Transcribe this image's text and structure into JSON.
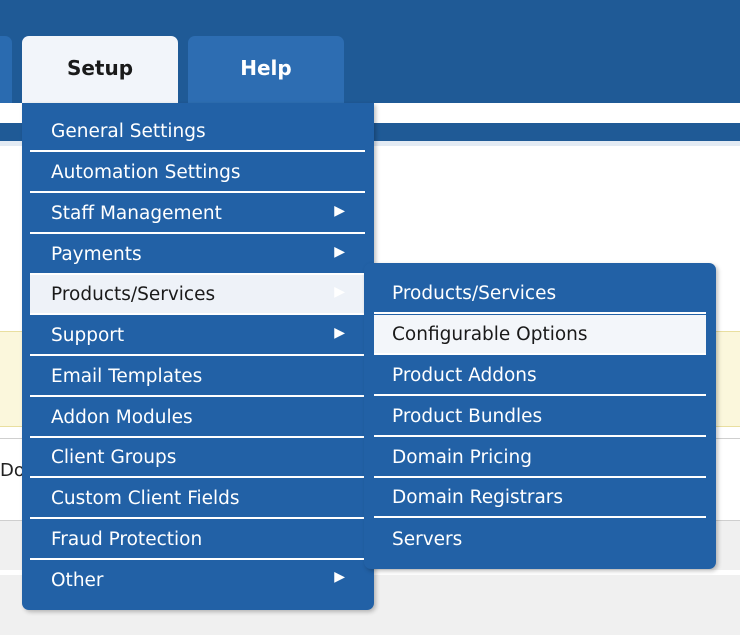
{
  "tabs": {
    "setup": "Setup",
    "help": "Help"
  },
  "background_partial_text": "Do",
  "setup_menu": [
    {
      "label": "General Settings",
      "has_submenu": false
    },
    {
      "label": "Automation Settings",
      "has_submenu": false
    },
    {
      "label": "Staff Management",
      "has_submenu": true
    },
    {
      "label": "Payments",
      "has_submenu": true
    },
    {
      "label": "Products/Services",
      "has_submenu": true,
      "active": true
    },
    {
      "label": "Support",
      "has_submenu": true
    },
    {
      "label": "Email Templates",
      "has_submenu": false
    },
    {
      "label": "Addon Modules",
      "has_submenu": false
    },
    {
      "label": "Client Groups",
      "has_submenu": false
    },
    {
      "label": "Custom Client Fields",
      "has_submenu": false
    },
    {
      "label": "Fraud Protection",
      "has_submenu": false
    },
    {
      "label": "Other",
      "has_submenu": true
    }
  ],
  "products_submenu": [
    {
      "label": "Products/Services"
    },
    {
      "label": "Configurable Options",
      "hovered": true
    },
    {
      "label": "Product Addons"
    },
    {
      "label": "Product Bundles"
    },
    {
      "label": "Domain Pricing"
    },
    {
      "label": "Domain Registrars"
    },
    {
      "label": "Servers"
    }
  ],
  "icons": {
    "submenu_arrow": "arrow-right-icon"
  },
  "colors": {
    "menu_bg": "#2261a6",
    "header_bg": "#1f5a96",
    "hover_bg": "#eef2f8"
  }
}
